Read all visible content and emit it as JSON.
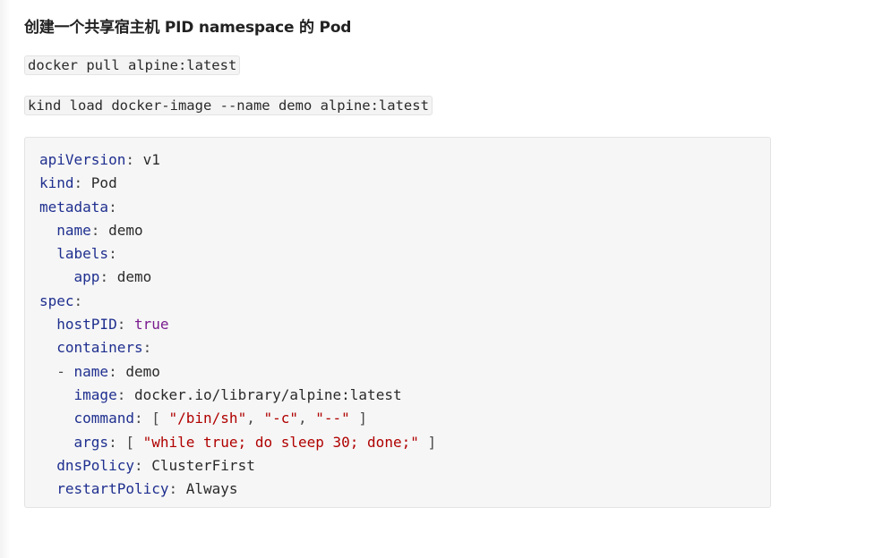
{
  "heading": "创建一个共享宿主机 PID namespace 的 Pod",
  "commands": [
    "docker pull alpine:latest",
    "kind load docker-image --name demo alpine:latest"
  ],
  "yaml": {
    "apiVersion": "v1",
    "kind": "Pod",
    "metadata_name": "demo",
    "labels_app": "demo",
    "hostPID": "true",
    "container_name": "demo",
    "image": "docker.io/library/alpine:latest",
    "command": [
      "\"/bin/sh\"",
      "\"-c\"",
      "\"--\""
    ],
    "args": [
      "\"while true; do sleep 30; done;\""
    ],
    "dnsPolicy": "ClusterFirst",
    "restartPolicy": "Always"
  }
}
